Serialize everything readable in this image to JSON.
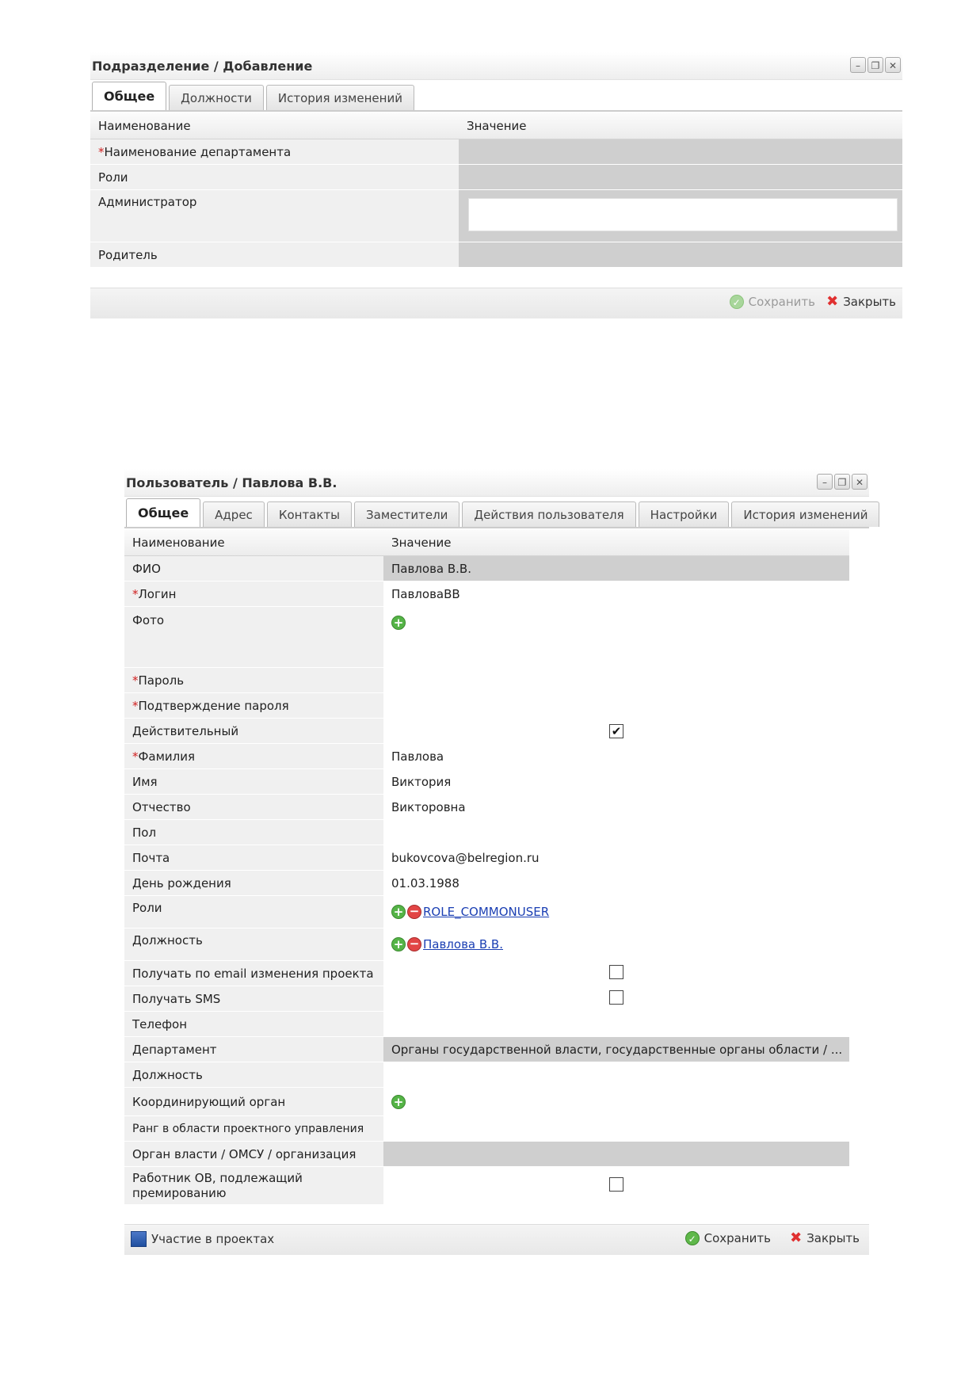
{
  "window1": {
    "title": "Подразделение / Добавление",
    "tabs": [
      "Общее",
      "Должности",
      "История изменений"
    ],
    "columns": [
      "Наименование",
      "Значение"
    ],
    "rows": [
      {
        "label": "Наименование департамента",
        "required": "*"
      },
      {
        "label": "Роли"
      },
      {
        "label": "Администратор"
      },
      {
        "label": "Родитель"
      }
    ],
    "save_label": "Сохранить",
    "close_label": "Закрыть"
  },
  "window2": {
    "title": "Пользователь / Павлова В.В.",
    "tabs": [
      "Общее",
      "Адрес",
      "Контакты",
      "Заместители",
      "Действия пользователя",
      "Настройки",
      "История изменений"
    ],
    "columns": [
      "Наименование",
      "Значение"
    ],
    "rows": {
      "fio": {
        "label": "ФИО",
        "value": "Павлова В.В."
      },
      "login": {
        "label": "Логин",
        "value": "ПавловаВВ",
        "required": "*"
      },
      "photo": {
        "label": "Фото"
      },
      "password": {
        "label": "Пароль",
        "required": "*"
      },
      "password_confirm": {
        "label": "Подтверждение пароля",
        "required": "*"
      },
      "active": {
        "label": "Действительный",
        "checked": true
      },
      "lastname": {
        "label": "Фамилия",
        "value": "Павлова",
        "required": "*"
      },
      "firstname": {
        "label": "Имя",
        "value": "Виктория"
      },
      "patronymic": {
        "label": "Отчество",
        "value": "Викторовна"
      },
      "gender": {
        "label": "Пол"
      },
      "email": {
        "label": "Почта",
        "value": "bukovcova@belregion.ru"
      },
      "birthday": {
        "label": "День рождения",
        "value": "01.03.1988"
      },
      "roles": {
        "label": "Роли",
        "link": "ROLE_COMMONUSER"
      },
      "position_link": {
        "label": "Должность",
        "link": "Павлова В.В."
      },
      "email_changes": {
        "label": "Получать по email изменения проекта",
        "checked": false
      },
      "sms": {
        "label": "Получать SMS",
        "checked": false
      },
      "phone": {
        "label": "Телефон"
      },
      "department": {
        "label": "Департамент",
        "value": "Органы государственной власти, государственные органы области / ..."
      },
      "position": {
        "label": "Должность"
      },
      "coord_body": {
        "label": "Координирующий орган"
      },
      "rank": {
        "label": "Ранг в области проектного управления"
      },
      "authority": {
        "label": "Орган власти / ОМСУ / организация"
      },
      "bonus": {
        "label": "Работник ОВ, подлежащий премированию",
        "checked": false
      }
    },
    "projects_label": "Участие в проектах",
    "save_label": "Сохранить",
    "close_label": "Закрыть"
  }
}
